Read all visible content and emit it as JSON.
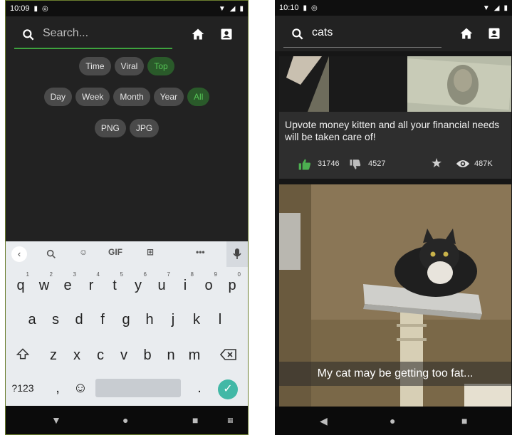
{
  "left": {
    "status": {
      "time": "10:09"
    },
    "search": {
      "placeholder": "Search..."
    },
    "filters": {
      "sort": [
        {
          "label": "Time",
          "selected": false
        },
        {
          "label": "Viral",
          "selected": false
        },
        {
          "label": "Top",
          "selected": true
        }
      ],
      "window": [
        {
          "label": "Day",
          "selected": false
        },
        {
          "label": "Week",
          "selected": false
        },
        {
          "label": "Month",
          "selected": false
        },
        {
          "label": "Year",
          "selected": false
        },
        {
          "label": "All",
          "selected": true
        }
      ],
      "type": [
        {
          "label": "PNG",
          "selected": false
        },
        {
          "label": "JPG",
          "selected": false
        }
      ]
    },
    "keyboard": {
      "toolbar": {
        "gif": "GIF",
        "more": "•••"
      },
      "row1": [
        "q",
        "w",
        "e",
        "r",
        "t",
        "y",
        "u",
        "i",
        "o",
        "p"
      ],
      "row1_hints": [
        "1",
        "2",
        "3",
        "4",
        "5",
        "6",
        "7",
        "8",
        "9",
        "0"
      ],
      "row2": [
        "a",
        "s",
        "d",
        "f",
        "g",
        "h",
        "j",
        "k",
        "l"
      ],
      "row3": [
        "z",
        "x",
        "c",
        "v",
        "b",
        "n",
        "m"
      ],
      "symbols": "?123",
      "comma": ",",
      "period": "."
    }
  },
  "right": {
    "status": {
      "time": "10:10"
    },
    "search": {
      "value": "cats"
    },
    "posts": [
      {
        "title": "Upvote money kitten and all your financial needs will be taken care of!",
        "upvotes": "31746",
        "downvotes": "4527",
        "views": "487K"
      },
      {
        "caption": "My cat may be getting too fat..."
      }
    ]
  },
  "colors": {
    "accent": "#3ea33e",
    "selected_chip_bg": "#2a5a2a",
    "selected_chip_text": "#56c556",
    "upvote": "#4caf50",
    "background": "#222222"
  }
}
